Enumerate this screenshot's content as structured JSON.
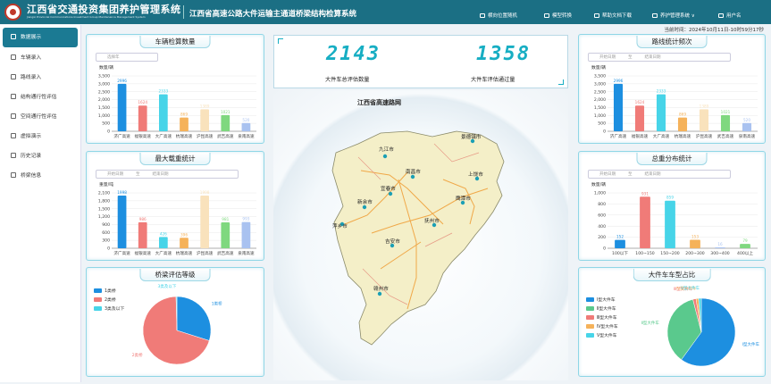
{
  "header": {
    "org": "江西省交通投资集团养护管理系统",
    "org_en": "Jiangxi Provincial Communications Investment Group Maintenance Management System",
    "system": "江西省高速公路大件运输主通道桥梁结构检算系统",
    "nav": [
      "横向位置随机",
      "模型转换",
      "帮助文档下载",
      "养护管理系统 ∨",
      "用户名"
    ],
    "time": "当前时间：2024年10月11日-10时59分17秒"
  },
  "sidebar": [
    "数据展示",
    "车辆录入",
    "路线录入",
    "结构通行性评估",
    "空间通行性评估",
    "虚拟演示",
    "历史记录",
    "桥梁信息"
  ],
  "center": {
    "total_vehicles": "2143",
    "total_vehicles_label": "大件车总评估数量",
    "passed": "1358",
    "passed_label": "大件车评估通过量"
  },
  "map": {
    "title": "江西省高速路网",
    "cities": [
      "九江市",
      "景德镇市",
      "南昌市",
      "上饶市",
      "宜春市",
      "新余市",
      "鹰潭市",
      "抚州市",
      "萍乡市",
      "吉安市",
      "赣州市"
    ]
  },
  "date_range": {
    "start": "开始日期",
    "to": "至",
    "end": "结束日期"
  },
  "panels": {
    "vehicle": {
      "title": "车辆检算数量",
      "unit": "数量/辆",
      "start": "选择年",
      "chart_data": {
        "type": "bar",
        "categories": [
          "济广高速",
          "福银高速",
          "大广高速",
          "杭瑞高速",
          "沪昆高速",
          "武吉高速",
          "泉南高速"
        ],
        "values": [
          2996,
          1624,
          2333,
          869,
          1389,
          1021,
          520
        ],
        "ylim": [
          0,
          3500
        ],
        "ticks": [
          "0",
          "500",
          "1,000",
          "1,500",
          "2,000",
          "2,500",
          "3,000",
          "3,500"
        ],
        "colors": [
          "#1d8fe0",
          "#f07b78",
          "#47d4e8",
          "#f5b25a",
          "#f9e2bc",
          "#7fd87f",
          "#a9c2f0"
        ]
      }
    },
    "weight": {
      "title": "最大载重统计",
      "unit": "重量/吨",
      "chart_data": {
        "type": "bar",
        "categories": [
          "济广高速",
          "福银高速",
          "大广高速",
          "杭瑞高速",
          "沪昆高速",
          "武吉高速",
          "泉南高速"
        ],
        "values": [
          1998,
          986,
          426,
          396,
          1998,
          981,
          993
        ],
        "ylim": [
          0,
          2100
        ],
        "ticks": [
          "0",
          "300",
          "600",
          "900",
          "1,200",
          "1,500",
          "1,800",
          "2,100"
        ],
        "colors": [
          "#1d8fe0",
          "#f07b78",
          "#47d4e8",
          "#f5b25a",
          "#f9e2bc",
          "#7fd87f",
          "#a9c2f0"
        ]
      }
    },
    "bridge": {
      "title": "桥梁评估等级",
      "chart_data": {
        "type": "pie",
        "labels": [
          "1类桥",
          "2类桥",
          "3类及以下"
        ],
        "values": [
          30,
          70,
          0.4
        ],
        "colors": [
          "#1d8fe0",
          "#f07b78",
          "#47d4e8"
        ]
      }
    },
    "route": {
      "title": "路线统计频次",
      "unit": "数量/辆",
      "chart_data": {
        "type": "bar",
        "categories": [
          "济广高速",
          "福银高速",
          "大广高速",
          "杭瑞高速",
          "沪昆高速",
          "武吉高速",
          "泉南高速"
        ],
        "values": [
          2996,
          1624,
          2333,
          869,
          1389,
          1021,
          520
        ],
        "ylim": [
          0,
          3500
        ],
        "ticks": [
          "0",
          "500",
          "1,000",
          "1,500",
          "2,000",
          "2,500",
          "3,000",
          "3,500"
        ],
        "colors": [
          "#1d8fe0",
          "#f07b78",
          "#47d4e8",
          "#f5b25a",
          "#f9e2bc",
          "#7fd87f",
          "#a9c2f0"
        ]
      }
    },
    "gross": {
      "title": "总重分布统计",
      "unit": "数量/辆",
      "chart_data": {
        "type": "bar",
        "categories": [
          "100以下",
          "100~150",
          "150~200",
          "200~300",
          "300~400",
          "400以上"
        ],
        "values": [
          152,
          931,
          859,
          153,
          16,
          79
        ],
        "ylim": [
          0,
          1000
        ],
        "ticks": [
          "0",
          "200",
          "400",
          "600",
          "800",
          "1,000"
        ],
        "colors": [
          "#1d8fe0",
          "#f07b78",
          "#47d4e8",
          "#f5b25a",
          "#a9c2f0",
          "#7fd87f"
        ]
      }
    },
    "vtype": {
      "title": "大件车车型占比",
      "chart_data": {
        "type": "pie",
        "labels": [
          "Ⅰ型大件车",
          "Ⅱ型大件车",
          "Ⅲ型大件车",
          "Ⅳ型大件车",
          "Ⅴ型大件车"
        ],
        "values": [
          60,
          36,
          1.5,
          1.2,
          1.3
        ],
        "colors": [
          "#1d8fe0",
          "#5ac98d",
          "#f07b78",
          "#f5b25a",
          "#47d4e8"
        ]
      }
    }
  }
}
